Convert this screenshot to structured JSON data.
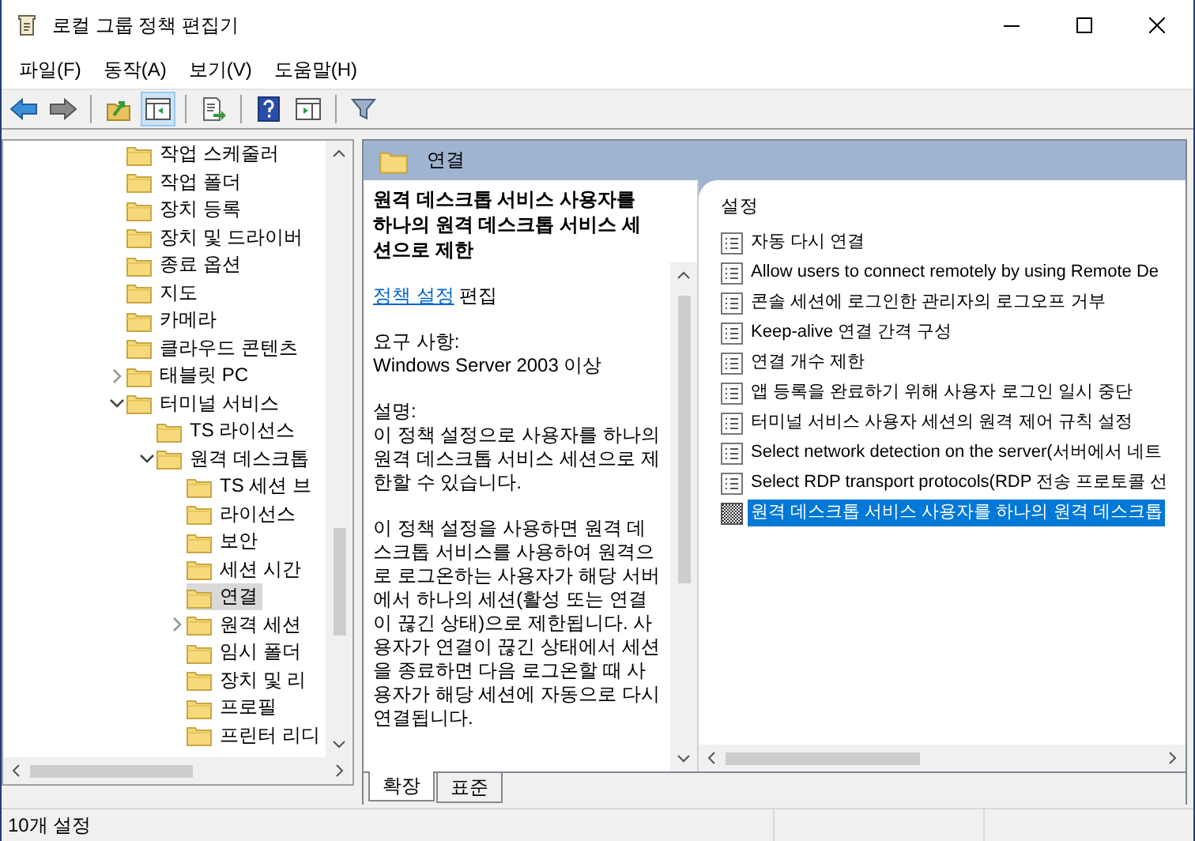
{
  "window": {
    "title": "로컬 그룹 정책 편집기"
  },
  "menu": [
    "파일(F)",
    "동작(A)",
    "보기(V)",
    "도움말(H)"
  ],
  "toolbar": [
    {
      "kind": "back",
      "pressed": false
    },
    {
      "kind": "forward",
      "pressed": false
    },
    {
      "kind": "sep"
    },
    {
      "kind": "up",
      "pressed": false
    },
    {
      "kind": "tree",
      "pressed": true
    },
    {
      "kind": "sep"
    },
    {
      "kind": "export",
      "pressed": false
    },
    {
      "kind": "sep"
    },
    {
      "kind": "help",
      "pressed": false
    },
    {
      "kind": "pane",
      "pressed": false
    },
    {
      "kind": "sep"
    },
    {
      "kind": "filter",
      "pressed": false
    }
  ],
  "tree": [
    {
      "label": "작업 스케줄러",
      "selected": false
    },
    {
      "label": "작업 폴더",
      "selected": false
    },
    {
      "label": "장치 등록",
      "selected": false
    },
    {
      "label": "장치 및 드라이버",
      "selected": false
    },
    {
      "label": "종료 옵션",
      "selected": false
    },
    {
      "label": "지도",
      "selected": false
    },
    {
      "label": "카메라",
      "selected": false
    },
    {
      "label": "클라우드 콘텐츠",
      "selected": false
    },
    {
      "label": "태블릿 PC",
      "selected": false,
      "expanded": false
    },
    {
      "label": "터미널 서비스",
      "selected": false,
      "expanded": true,
      "children": [
        {
          "label": "TS 라이선스",
          "selected": false
        },
        {
          "label": "원격 데스크톱",
          "selected": false,
          "expanded": true,
          "children": [
            {
              "label": "TS 세션 브",
              "selected": false
            },
            {
              "label": "라이선스",
              "selected": false
            },
            {
              "label": "보안",
              "selected": false
            },
            {
              "label": "세션 시간",
              "selected": false
            },
            {
              "label": "연결",
              "selected": true
            },
            {
              "label": "원격 세션",
              "selected": false,
              "expanded": false
            },
            {
              "label": "임시 폴더",
              "selected": false
            },
            {
              "label": "장치 및 리",
              "selected": false
            },
            {
              "label": "프로필",
              "selected": false
            },
            {
              "label": "프린터 리디",
              "selected": false
            }
          ]
        }
      ]
    }
  ],
  "header": {
    "title": "연결"
  },
  "description": {
    "title": "원격 데스크톱 서비스 사용자를 하나의 원격 데스크톱 서비스 세션으로 제한",
    "link": "정책 설정",
    "link_suffix": "편집",
    "requirements_label": "요구 사항:",
    "requirements": "Windows Server 2003 이상",
    "description_label": "설명:",
    "paragraphs": [
      "이 정책 설정으로 사용자를 하나의 원격 데스크톱 서비스 세션으로 제한할 수 있습니다.",
      "이 정책 설정을 사용하면 원격 데스크톱 서비스를 사용하여 원격으로 로그온하는 사용자가 해당 서버에서 하나의 세션(활성 또는 연결이 끊긴 상태)으로 제한됩니다. 사용자가 연결이 끊긴 상태에서 세션을 종료하면 다음 로그온할 때 사용자가 해당 세션에 자동으로 다시 연결됩니다."
    ]
  },
  "settings": {
    "column": "설정",
    "rows": [
      {
        "label": "자동 다시 연결",
        "selected": false
      },
      {
        "label": "Allow users to connect remotely by using Remote De",
        "selected": false
      },
      {
        "label": "콘솔 세션에 로그인한 관리자의 로그오프 거부",
        "selected": false
      },
      {
        "label": "Keep-alive 연결 간격 구성",
        "selected": false
      },
      {
        "label": "연결 개수 제한",
        "selected": false
      },
      {
        "label": "앱 등록을 완료하기 위해 사용자 로그인 일시 중단",
        "selected": false
      },
      {
        "label": "터미널 서비스 사용자 세션의 원격 제어 규칙 설정",
        "selected": false
      },
      {
        "label": "Select network detection on the server(서버에서 네트",
        "selected": false
      },
      {
        "label": "Select RDP transport protocols(RDP 전송 프로토콜 선",
        "selected": false
      },
      {
        "label": "원격 데스크톱 서비스 사용자를 하나의 원격 데스크톱",
        "selected": true
      }
    ]
  },
  "tabs": [
    {
      "label": "확장",
      "selected": true
    },
    {
      "label": "표준",
      "selected": false
    }
  ],
  "status_bar": {
    "text": "10개 설정"
  }
}
